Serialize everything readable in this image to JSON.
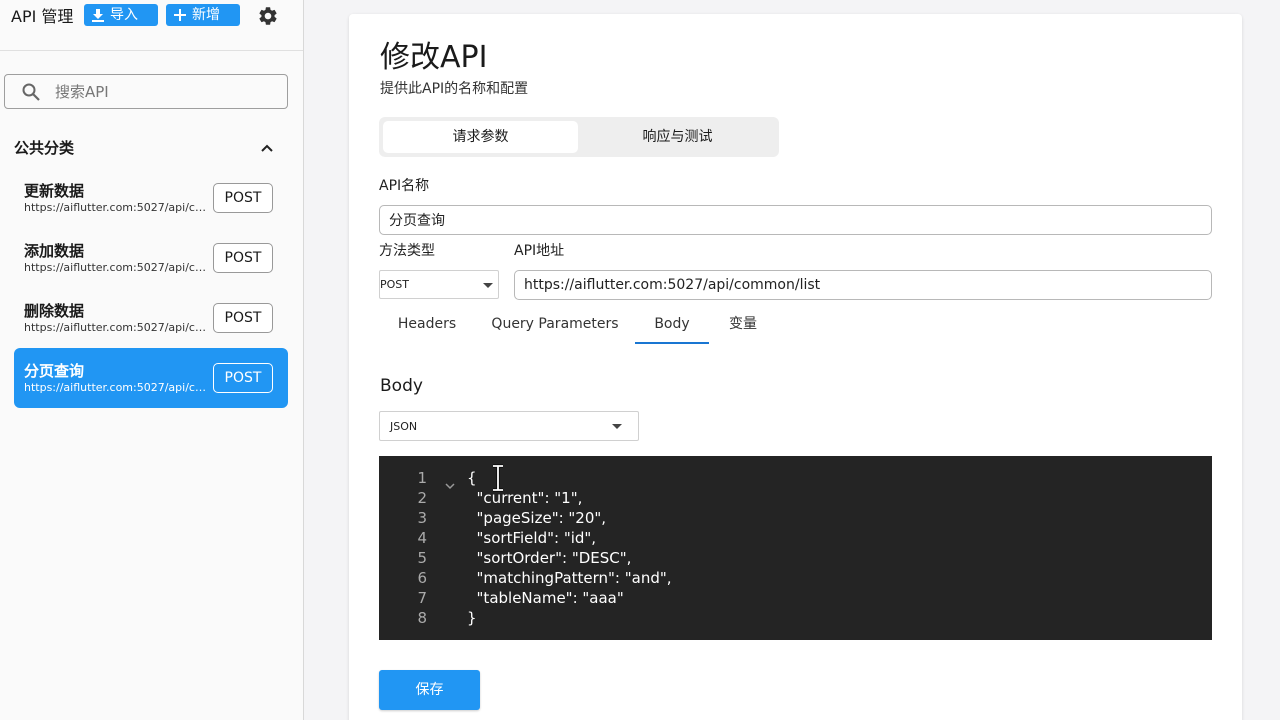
{
  "header": {
    "title": "API 管理",
    "import_label": "导入",
    "new_label": "新增"
  },
  "search": {
    "placeholder": "搜索API"
  },
  "sidebar": {
    "category": "公共分类",
    "items": [
      {
        "name": "更新数据",
        "url": "https://aiflutter.com:5027/api/co...",
        "method": "POST"
      },
      {
        "name": "添加数据",
        "url": "https://aiflutter.com:5027/api/co...",
        "method": "POST"
      },
      {
        "name": "删除数据",
        "url": "https://aiflutter.com:5027/api/co...",
        "method": "POST"
      },
      {
        "name": "分页查询",
        "url": "https://aiflutter.com:5027/api/co...",
        "method": "POST",
        "active": true
      }
    ]
  },
  "main": {
    "title": "修改API",
    "subtitle": "提供此API的名称和配置",
    "seg_tabs": [
      "请求参数",
      "响应与测试"
    ],
    "name_label": "API名称",
    "name_value": "分页查询",
    "method_label": "方法类型",
    "method_value": "POST",
    "url_label": "API地址",
    "url_value": "https://aiflutter.com:5027/api/common/list",
    "tabs": [
      "Headers",
      "Query Parameters",
      "Body",
      "变量"
    ],
    "active_tab": "Body",
    "body_title": "Body",
    "body_type": "JSON",
    "code_lines": [
      "{",
      "  \"current\": \"1\",",
      "  \"pageSize\": \"20\",",
      "  \"sortField\": \"id\",",
      "  \"sortOrder\": \"DESC\",",
      "  \"matchingPattern\": \"and\",",
      "  \"tableName\": \"aaa\"",
      "}"
    ],
    "line_numbers": [
      "1",
      "2",
      "3",
      "4",
      "5",
      "6",
      "7",
      "8"
    ],
    "save_label": "保存"
  },
  "colors": {
    "accent": "#2196f3",
    "editor_bg": "#242424",
    "tab_indicator": "#1976d2"
  },
  "icons": [
    "download-icon",
    "plus-icon",
    "gear-icon",
    "search-icon",
    "chevron-up-icon",
    "caret-down-icon",
    "fold-chevron-icon",
    "text-cursor-icon"
  ]
}
